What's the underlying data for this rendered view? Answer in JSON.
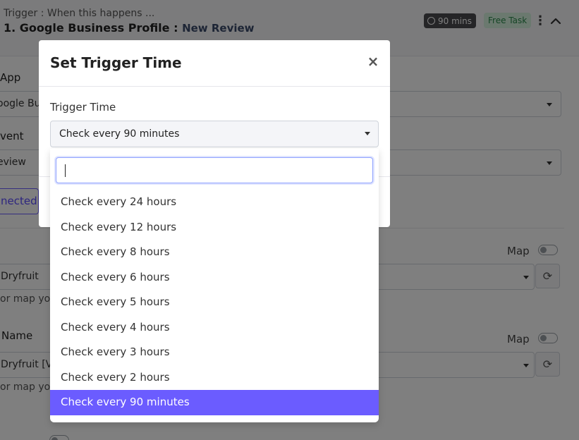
{
  "header": {
    "caption": "Trigger : When this happens ...",
    "title_main": "1. Google Business Profile :",
    "title_sub": "New Review",
    "time_badge": "90 mins",
    "free_badge": "Free Task"
  },
  "background_form": {
    "app_label": "App",
    "app_value": "oogle Bus",
    "event_label": "vent",
    "event_value": "eview",
    "connected_label": "nected",
    "map_label": "Map",
    "field1_value": "Dryfruit",
    "field1_hint": "or map you",
    "field2_label": "Name",
    "field2_value": "Dryfruit [Va",
    "field2_hint": "or map you"
  },
  "modal": {
    "title": "Set Trigger Time",
    "close_glyph": "×",
    "field_label": "Trigger Time",
    "selected_value": "Check every 90 minutes",
    "search_value": ""
  },
  "dropdown": {
    "options": [
      "Check every 24 hours",
      "Check every 12 hours",
      "Check every 8 hours",
      "Check every 6 hours",
      "Check every 5 hours",
      "Check every 4 hours",
      "Check every 3 hours",
      "Check every 2 hours",
      "Check every 90 minutes"
    ],
    "selected_index": 8
  },
  "colors": {
    "accent": "#6b5cff",
    "free_badge_bg": "#d6f2df",
    "free_badge_text": "#2a8a4b",
    "time_badge_bg": "#4a4a4f"
  }
}
